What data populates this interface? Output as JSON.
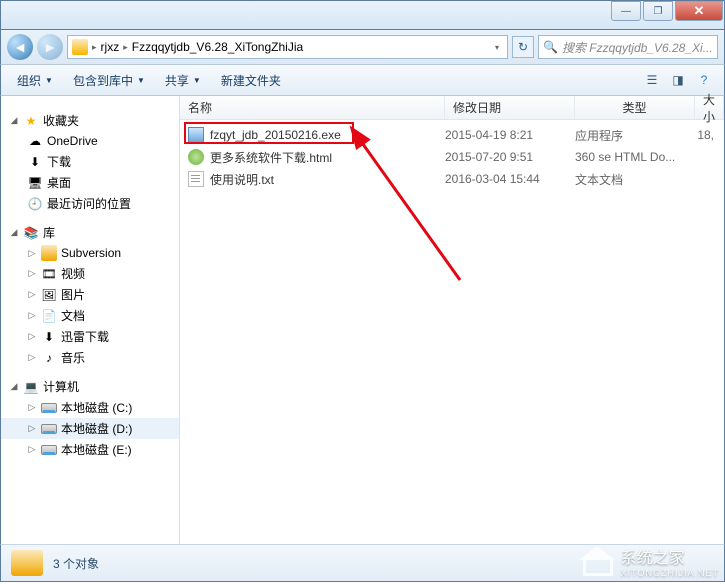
{
  "titlebar": {
    "min": "—",
    "max": "❐",
    "close": "✕"
  },
  "address": {
    "crumb1": "rjxz",
    "crumb2": "Fzzqqytjdb_V6.28_XiTongZhiJia",
    "refresh": "↻"
  },
  "search": {
    "placeholder": "搜索 Fzzqqytjdb_V6.28_Xi..."
  },
  "toolbar": {
    "organize": "组织",
    "include": "包含到库中",
    "share": "共享",
    "newfolder": "新建文件夹"
  },
  "sidebar": {
    "favorites": "收藏夹",
    "onedrive": "OneDrive",
    "downloads": "下载",
    "desktop": "桌面",
    "recent": "最近访问的位置",
    "libraries": "库",
    "subversion": "Subversion",
    "videos": "视频",
    "pictures": "图片",
    "documents": "文档",
    "xunlei": "迅雷下载",
    "music": "音乐",
    "computer": "计算机",
    "drive_c": "本地磁盘 (C:)",
    "drive_d": "本地磁盘 (D:)",
    "drive_e": "本地磁盘 (E:)"
  },
  "columns": {
    "name": "名称",
    "date": "修改日期",
    "type": "类型",
    "size": "大小"
  },
  "files": [
    {
      "name": "fzqyt_jdb_20150216.exe",
      "date": "2015-04-19 8:21",
      "type": "应用程序",
      "size": "18,",
      "icon": "exe"
    },
    {
      "name": "更多系统软件下载.html",
      "date": "2015-07-20 9:51",
      "type": "360 se HTML Do...",
      "size": "",
      "icon": "html"
    },
    {
      "name": "使用说明.txt",
      "date": "2016-03-04 15:44",
      "type": "文本文档",
      "size": "",
      "icon": "txt"
    }
  ],
  "status": {
    "text": "3 个对象"
  },
  "watermark": {
    "brand": "系统之家",
    "url": "XITONGZHIJIA.NET"
  }
}
